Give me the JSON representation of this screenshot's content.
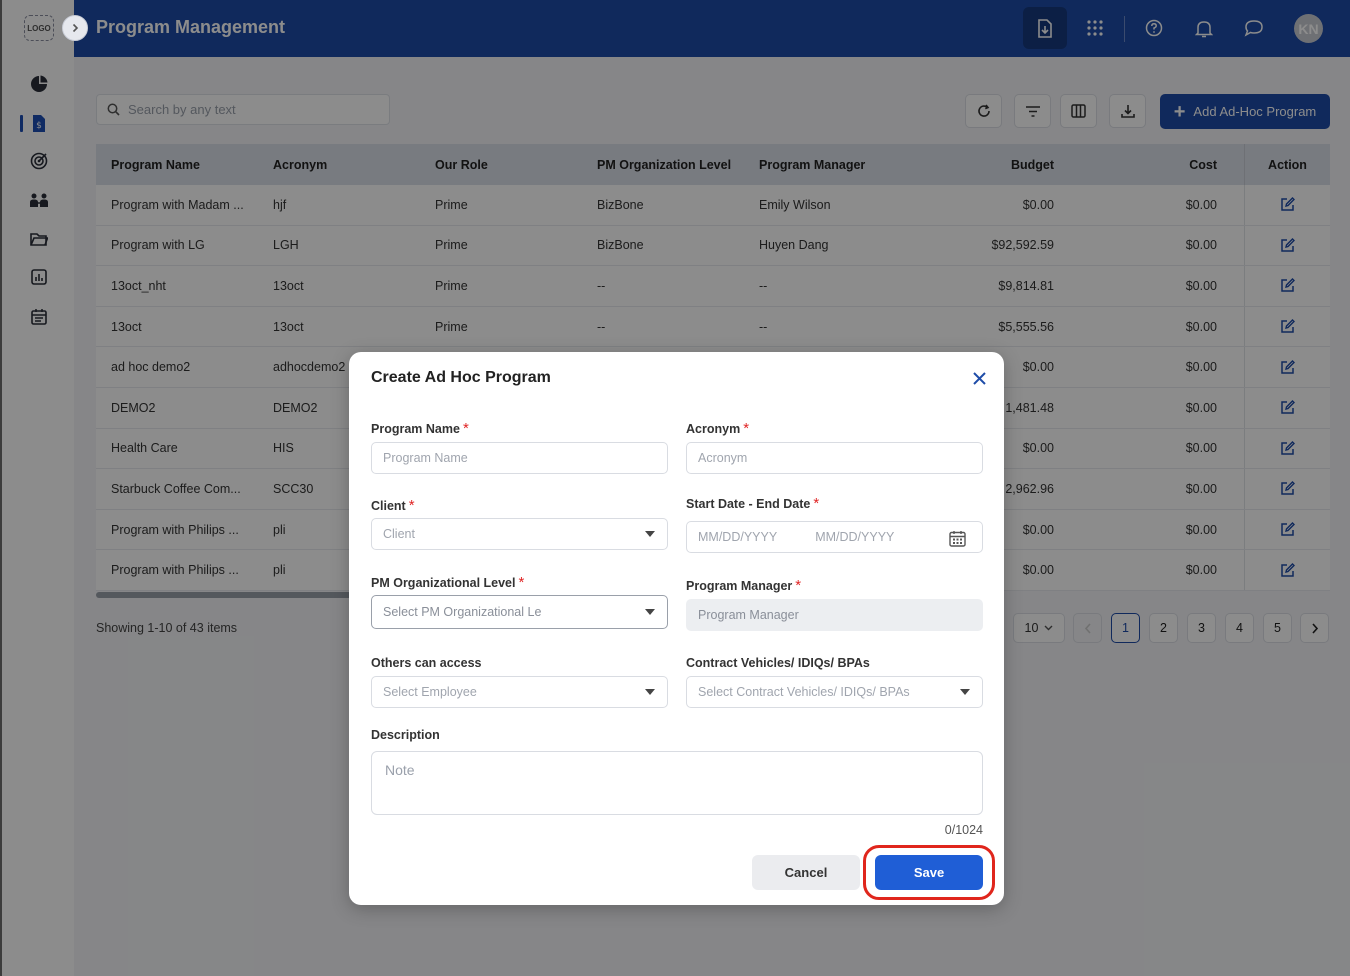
{
  "app": {
    "title": "Program Management",
    "logo_text": "LOGO",
    "avatar_initials": "KN"
  },
  "header_icons": [
    "import-icon",
    "apps-grid-icon",
    "help-icon",
    "bell-icon",
    "chat-icon"
  ],
  "sidebar_icons": [
    "dashboard-pie-icon",
    "program-doc-icon",
    "target-icon",
    "team-icon",
    "folder-icon",
    "report-chart-icon",
    "calendar-icon"
  ],
  "toolbar": {
    "search_placeholder": "Search by any text",
    "add_label": "Add Ad-Hoc Program"
  },
  "table": {
    "columns": [
      "Program Name",
      "Acronym",
      "Our Role",
      "PM Organization Level",
      "Program Manager",
      "Budget",
      "Cost",
      "Action"
    ],
    "rows": [
      {
        "name": "Program with Madam ...",
        "acronym": "hjf",
        "role": "Prime",
        "level": "BizBone",
        "manager": "Emily Wilson",
        "budget": "$0.00",
        "cost": "$0.00"
      },
      {
        "name": "Program with LG",
        "acronym": "LGH",
        "role": "Prime",
        "level": "BizBone",
        "manager": "Huyen Dang",
        "budget": "$92,592.59",
        "cost": "$0.00"
      },
      {
        "name": "13oct_nht",
        "acronym": "13oct",
        "role": "Prime",
        "level": "--",
        "manager": "--",
        "budget": "$9,814.81",
        "cost": "$0.00"
      },
      {
        "name": "13oct",
        "acronym": "13oct",
        "role": "Prime",
        "level": "--",
        "manager": "--",
        "budget": "$5,555.56",
        "cost": "$0.00"
      },
      {
        "name": "ad hoc demo2",
        "acronym": "adhocdemo2",
        "role": "",
        "level": "",
        "manager": "",
        "budget": "$0.00",
        "cost": "$0.00"
      },
      {
        "name": "DEMO2",
        "acronym": "DEMO2",
        "role": "",
        "level": "",
        "manager": "",
        "budget": "1,481.48",
        "cost": "$0.00"
      },
      {
        "name": "Health Care",
        "acronym": "HIS",
        "role": "",
        "level": "",
        "manager": "",
        "budget": "$0.00",
        "cost": "$0.00"
      },
      {
        "name": "Starbuck Coffee Com...",
        "acronym": "SCC30",
        "role": "",
        "level": "",
        "manager": "",
        "budget": "2,962.96",
        "cost": "$0.00"
      },
      {
        "name": "Program with Philips ...",
        "acronym": "pli",
        "role": "",
        "level": "",
        "manager": "",
        "budget": "$0.00",
        "cost": "$0.00"
      },
      {
        "name": "Program with Philips ...",
        "acronym": "pli",
        "role": "",
        "level": "",
        "manager": "",
        "budget": "$0.00",
        "cost": "$0.00"
      }
    ]
  },
  "footer": {
    "showing": "Showing 1-10 of 43 items",
    "page_size": "10",
    "pages": [
      "1",
      "2",
      "3",
      "4",
      "5"
    ],
    "current_page": "1"
  },
  "modal": {
    "title": "Create Ad Hoc Program",
    "required_mark": "*",
    "program_name": {
      "label": "Program Name",
      "placeholder": "Program Name"
    },
    "acronym": {
      "label": "Acronym",
      "placeholder": "Acronym"
    },
    "client": {
      "label": "Client",
      "placeholder": "Client"
    },
    "dates": {
      "label": "Start Date - End Date",
      "start_placeholder": "MM/DD/YYYY",
      "end_placeholder": "MM/DD/YYYY"
    },
    "pm_level": {
      "label": "PM Organizational Level",
      "placeholder": "Select PM Organizational Le"
    },
    "program_manager": {
      "label": "Program Manager",
      "placeholder": "Program Manager"
    },
    "others_access": {
      "label": "Others can access",
      "placeholder": "Select Employee"
    },
    "contract_vehicles": {
      "label": "Contract Vehicles/ IDIQs/ BPAs",
      "placeholder": "Select Contract Vehicles/ IDIQs/ BPAs"
    },
    "description": {
      "label": "Description",
      "placeholder": "Note",
      "counter": "0/1024"
    },
    "cancel_label": "Cancel",
    "save_label": "Save"
  },
  "colors": {
    "brand_blue": "#1e4ca8",
    "save_blue": "#1f5ed6",
    "highlight_red": "#e0261c",
    "required_red": "#e02424"
  }
}
